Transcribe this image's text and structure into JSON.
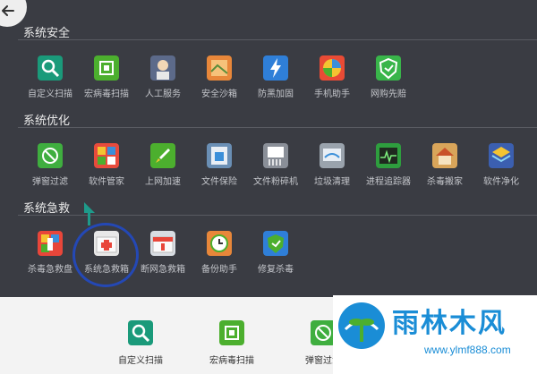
{
  "sections": [
    {
      "title": "系统安全",
      "tools": [
        {
          "label": "自定义扫描",
          "icon": "magnifier-icon",
          "color": "#1a9a7a"
        },
        {
          "label": "宏病毒扫描",
          "icon": "qr-scan-icon",
          "color": "#4caf2e"
        },
        {
          "label": "人工服务",
          "icon": "customer-service-icon",
          "color": "#5c6a8a"
        },
        {
          "label": "安全沙箱",
          "icon": "sandbox-icon",
          "color": "#e8873a"
        },
        {
          "label": "防黑加固",
          "icon": "lightning-shield-icon",
          "color": "#2f7fd8"
        },
        {
          "label": "手机助手",
          "icon": "phone-assistant-icon",
          "color": "#e94b35"
        },
        {
          "label": "网购先赔",
          "icon": "shopping-shield-icon",
          "color": "#39b54a"
        }
      ]
    },
    {
      "title": "系统优化",
      "tools": [
        {
          "label": "弹窗过滤",
          "icon": "popup-block-icon",
          "color": "#3fae3f"
        },
        {
          "label": "软件管家",
          "icon": "software-manager-icon",
          "color": "#e84b3c"
        },
        {
          "label": "上网加速",
          "icon": "rocket-icon",
          "color": "#4caf2e"
        },
        {
          "label": "文件保险",
          "icon": "file-safe-icon",
          "color": "#6a8fb5"
        },
        {
          "label": "文件粉碎机",
          "icon": "file-shredder-icon",
          "color": "#8a8f98"
        },
        {
          "label": "垃圾清理",
          "icon": "trash-clean-icon",
          "color": "#9aa3ad"
        },
        {
          "label": "进程追踪器",
          "icon": "process-tracker-icon",
          "color": "#2e9e3e"
        },
        {
          "label": "杀毒搬家",
          "icon": "house-move-icon",
          "color": "#d9a55a"
        },
        {
          "label": "软件净化",
          "icon": "software-purify-icon",
          "color": "#3b5fb0"
        }
      ]
    },
    {
      "title": "系统急救",
      "tools": [
        {
          "label": "杀毒急救盘",
          "icon": "rescue-usb-icon",
          "color": "#e8463a"
        },
        {
          "label": "系统急救箱",
          "icon": "first-aid-kit-icon",
          "color": "#e8e8e8"
        },
        {
          "label": "断网急救箱",
          "icon": "network-aid-kit-icon",
          "color": "#d8dde3"
        },
        {
          "label": "备份助手",
          "icon": "backup-clock-icon",
          "color": "#e8873a"
        },
        {
          "label": "修复杀毒",
          "icon": "repair-shield-icon",
          "color": "#2f7fd8"
        }
      ]
    }
  ],
  "bottom_tools": [
    {
      "label": "自定义扫描",
      "icon": "magnifier-icon",
      "color": "#1a9a7a"
    },
    {
      "label": "宏病毒扫描",
      "icon": "qr-scan-icon",
      "color": "#4caf2e"
    },
    {
      "label": "弹窗过滤",
      "icon": "popup-block-icon",
      "color": "#3fae3f"
    }
  ],
  "watermark": {
    "title": "雨林木风",
    "url": "www.ylmf888.com"
  },
  "annotation_color": "#2448b5",
  "arrow_color": "#1e9a8a"
}
